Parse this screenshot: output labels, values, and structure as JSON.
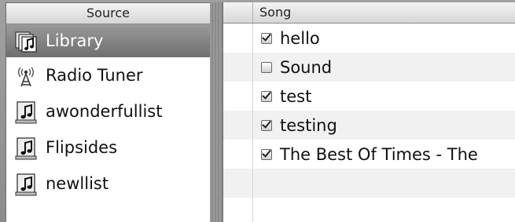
{
  "source": {
    "header": "Source",
    "items": [
      {
        "label": "Library",
        "icon": "library-icon",
        "selected": true
      },
      {
        "label": "Radio Tuner",
        "icon": "radio-tower-icon",
        "selected": false
      },
      {
        "label": "awonderfullist",
        "icon": "playlist-icon",
        "selected": false
      },
      {
        "label": "Flipsides",
        "icon": "playlist-icon",
        "selected": false
      },
      {
        "label": "newllist",
        "icon": "playlist-icon",
        "selected": false
      }
    ]
  },
  "songs": {
    "header": "Song",
    "rows": [
      {
        "title": "hello",
        "checked": true
      },
      {
        "title": "Sound",
        "checked": false
      },
      {
        "title": "test",
        "checked": true
      },
      {
        "title": "testing",
        "checked": true
      },
      {
        "title": "The Best Of Times - The",
        "checked": true
      }
    ]
  }
}
